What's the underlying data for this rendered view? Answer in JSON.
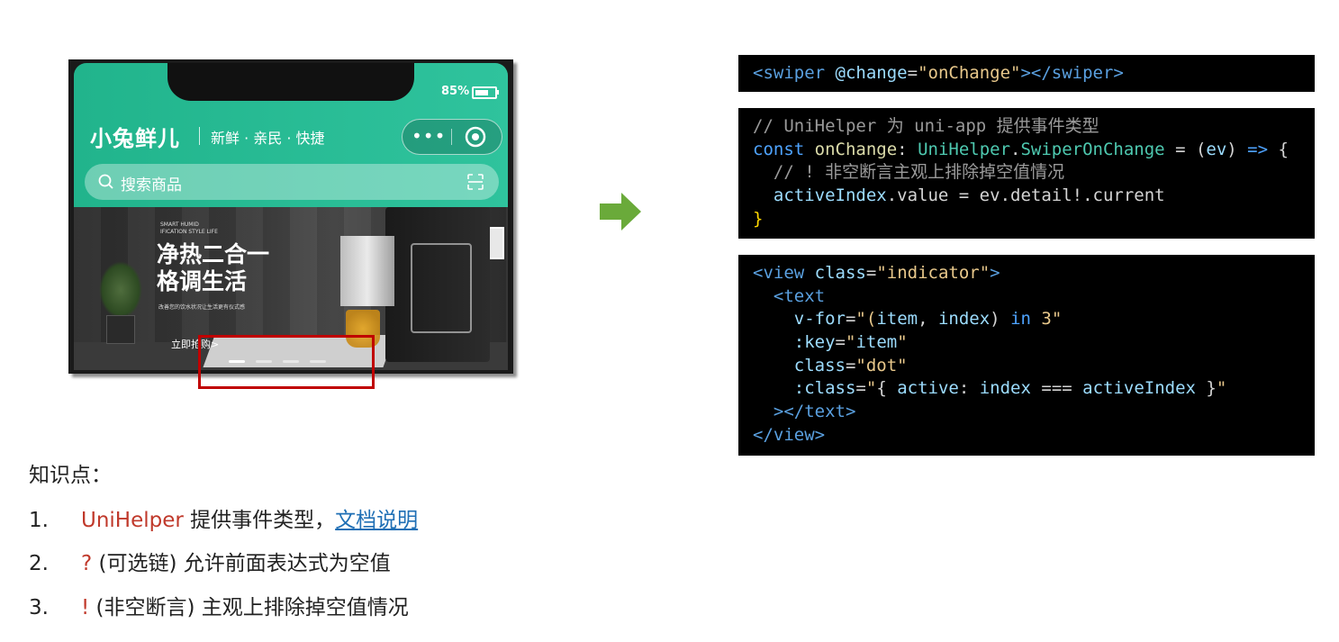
{
  "phone": {
    "battery": "85%",
    "brand": "小兔鲜儿",
    "slogan": "新鲜 · 亲民 · 快捷",
    "capsule_more": "•••",
    "search_placeholder": "搜索商品",
    "banner": {
      "small_en": "SMART HUMID\nIFICATION STYLE LIFE",
      "headline_1": "净热二合一",
      "headline_2": "格调生活",
      "subline": "改善您的饮水状况让生活更有仪式感",
      "cta": "立即抢购>"
    },
    "indicator": {
      "count": 5,
      "active_index": 0
    }
  },
  "code_blocks": {
    "block1": [
      "<swiper @change=\"onChange\"></swiper>"
    ],
    "block2": [
      "// UniHelper 为 uni-app 提供事件类型",
      "const onChange: UniHelper.SwiperOnChange = (ev) => {",
      "  // ! 非空断言主观上排除掉空值情况",
      "  activeIndex.value = ev.detail!.current",
      "}"
    ],
    "block3": [
      "<view class=\"indicator\">",
      "  <text",
      "    v-for=\"(item, index) in 3\"",
      "    :key=\"item\"",
      "    class=\"dot\"",
      "    :class=\"{ active: index === activeIndex }\"",
      "  ></text>",
      "</view>"
    ]
  },
  "knowledge": {
    "title": "知识点：",
    "items": [
      {
        "num": "1.",
        "highlight": "UniHelper",
        "text": " 提供事件类型，",
        "link": "文档说明"
      },
      {
        "num": "2.",
        "highlight": "?",
        "text": " (可选链) 允许前面表达式为空值"
      },
      {
        "num": "3.",
        "highlight": "!",
        "text": " (非空断言)  主观上排除掉空值情况"
      }
    ]
  },
  "colors": {
    "header_green": "#21b48c",
    "highlight_red": "#c00000",
    "arrow_green": "#6aaa3a",
    "link_blue": "#1f6fb5",
    "code_bg": "#000000"
  }
}
